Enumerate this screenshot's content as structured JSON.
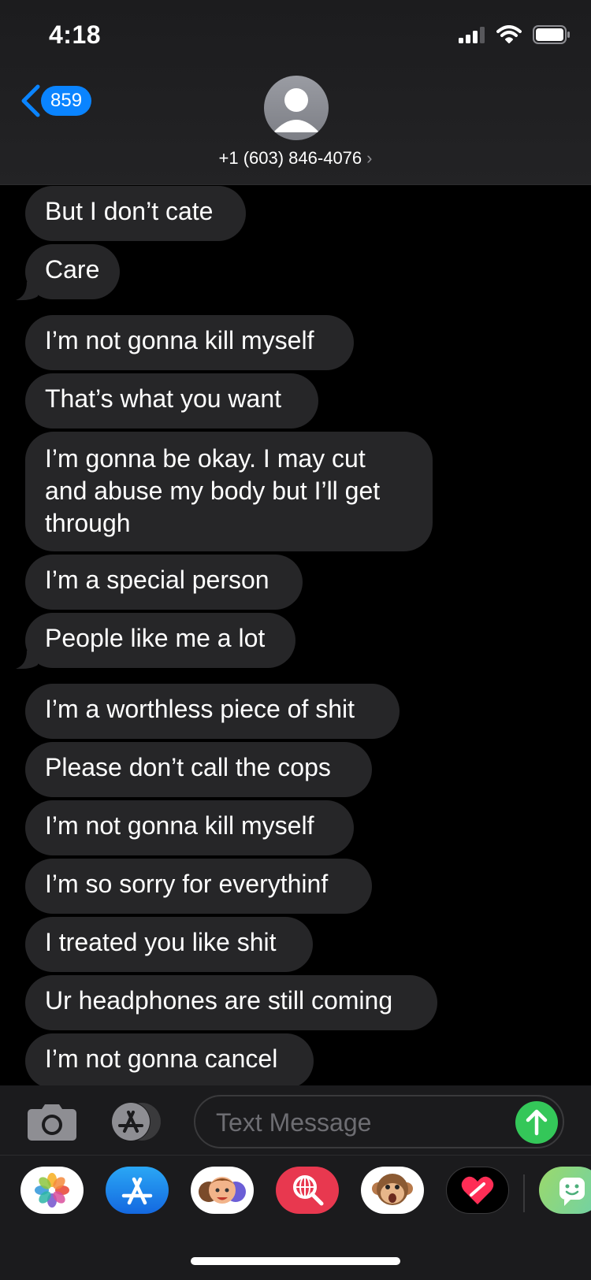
{
  "status": {
    "time": "4:18"
  },
  "header": {
    "back_count": "859",
    "contact": "+1 (603) 846-4076",
    "contact_chevron": "›"
  },
  "messages": [
    "But I don’t cate",
    "Care",
    "I’m not gonna kill myself",
    "That’s what you want",
    "I’m gonna be okay. I may cut and abuse my body but I’ll get through",
    "I’m a special person",
    "People like me a lot",
    "I’m a worthless piece of shit",
    "Please don’t call the cops",
    "I’m not gonna kill myself",
    "I’m so sorry for everythinf",
    "I treated you like shit",
    "Ur headphones are still coming",
    "I’m not gonna cancel"
  ],
  "input": {
    "placeholder": "Text Message"
  },
  "app_drawer": [
    "photos-icon",
    "app-store-icon",
    "memoji-icon",
    "web-search-icon",
    "animoji-icon",
    "digital-touch-icon",
    "sticker-app-icon"
  ],
  "colors": {
    "accent": "#0a84ff",
    "bubble": "#262628",
    "send": "#34c759"
  }
}
